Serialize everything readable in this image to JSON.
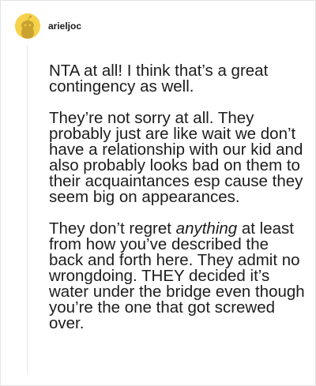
{
  "comment": {
    "username": "arieljoc",
    "avatar_icon": "snoo-avatar-icon",
    "avatar_color": "#f5d24a",
    "paragraphs": [
      {
        "text": "NTA at all! I think that’s a great contingency as well."
      },
      {
        "text": "They’re not sorry at all. They probably just are like wait we don’t have a relationship with our kid and also probably looks bad on them to their acquaintances esp cause they seem big on appearances."
      },
      {
        "before": "They don’t regret ",
        "emphasis": "anything",
        "after": " at least from how you’ve described the back and forth here. They admit no wrongdoing. THEY decided it’s water under the bridge even though you’re the one that got screwed over."
      }
    ]
  }
}
